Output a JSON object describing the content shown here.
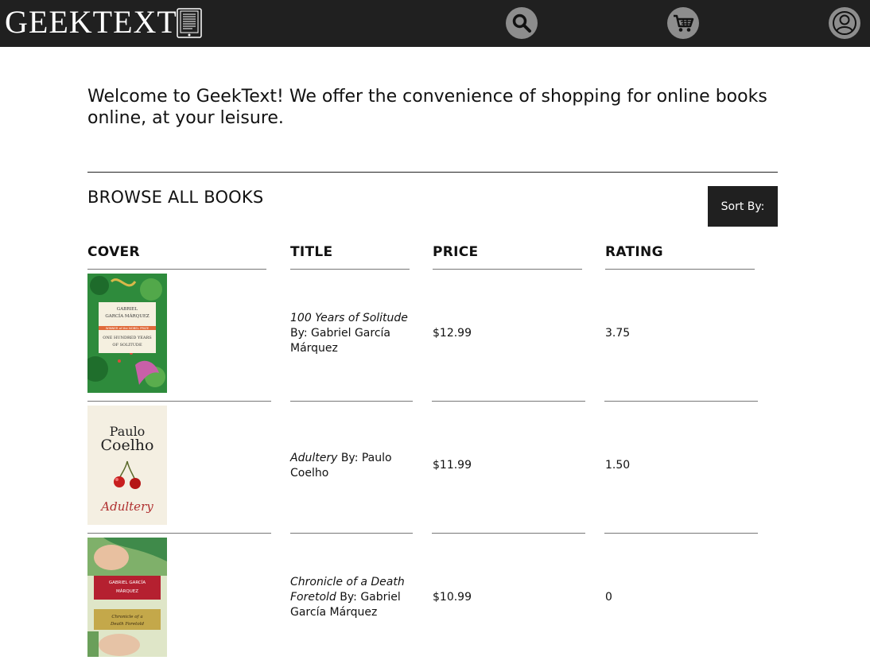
{
  "header": {
    "logo": "GEEKTEXT",
    "icons": [
      "book-icon",
      "search-icon",
      "cart-icon",
      "user-icon"
    ]
  },
  "welcome": "Welcome to GeekText! We offer the convenience of shopping for online books online, at your leisure.",
  "browse": {
    "heading": "BROWSE ALL BOOKS",
    "sort_label": "Sort By:"
  },
  "table": {
    "columns": [
      "COVER",
      "TITLE",
      "PRICE",
      "RATING"
    ],
    "rows": [
      {
        "title": "100 Years of Solitude",
        "byline": "By: Gabriel García Márquez",
        "price": "$12.99",
        "rating": "3.75"
      },
      {
        "title": "Adultery",
        "byline": "By: Paulo Coelho",
        "price": "$11.99",
        "rating": "1.50"
      },
      {
        "title": "Chronicle of a Death Foretold",
        "byline": "By: Gabriel García Márquez",
        "price": "$10.99",
        "rating": "0"
      }
    ]
  },
  "covers": [
    {
      "lines": [
        "GABRIEL",
        "GARCÍA MÁRQUEZ",
        "WINNER of the NOBEL PRIZE",
        "ONE HUNDRED YEARS",
        "OF SOLITUDE"
      ]
    },
    {
      "lines": [
        "Paulo",
        "Coelho",
        "Adultery"
      ]
    },
    {
      "lines": [
        "GABRIEL GARCÍA",
        "MÁRQUEZ",
        "Chronicle of a",
        "Death Foretold"
      ]
    }
  ]
}
